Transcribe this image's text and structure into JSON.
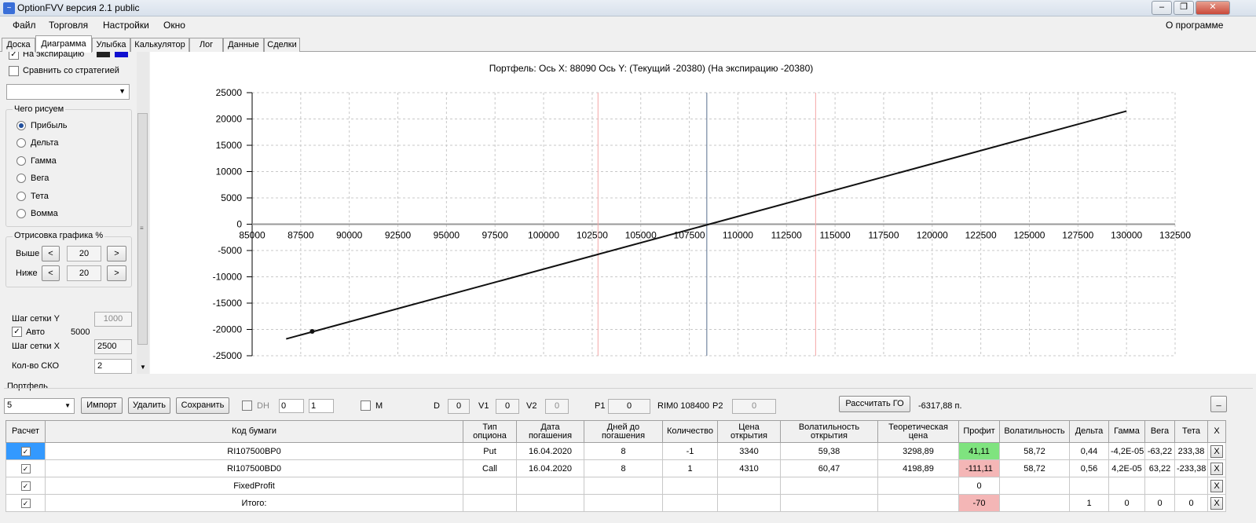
{
  "window": {
    "title": "OptionFVV версия 2.1 public"
  },
  "menu": {
    "items": [
      "Файл",
      "Торговля",
      "Настройки",
      "Окно"
    ],
    "about": "О программе"
  },
  "tabs": [
    "Доска",
    "Диаграмма",
    "Улыбка",
    "Калькулятор",
    "Лог",
    "Данные",
    "Сделки"
  ],
  "left": {
    "expiry_label": "На экспирацию",
    "compare_label": "Сравнить со стратегией",
    "strategy_value": "",
    "draw_group": "Чего рисуем",
    "options": [
      "Прибыль",
      "Дельта",
      "Гамма",
      "Вега",
      "Тета",
      "Вомма"
    ],
    "render_group": "Отрисовка графика %",
    "above_label": "Выше",
    "above_value": "20",
    "below_label": "Ниже",
    "below_value": "20",
    "prev": "<",
    "next": ">",
    "grid_y_label": "Шаг сетки Y",
    "grid_y_value": "1000",
    "auto_label": "Авто",
    "auto_value": "5000",
    "grid_x_label": "Шаг сетки X",
    "grid_x_value": "2500",
    "sko_label": "Кол-во СКО",
    "sko_value": "2"
  },
  "chart_header": "Портфель: Ось X: 88090 Ось Y:  (Текущий -20380)  (На экспирацию -20380)",
  "chart_data": {
    "type": "line",
    "title": "Портфель: Ось X: 88090 Ось Y:  (Текущий -20380)  (На экспирацию -20380)",
    "xlim": [
      85000,
      132500
    ],
    "ylim": [
      -25000,
      25000
    ],
    "x_ticks": [
      "85000",
      "87500",
      "90000",
      "92500",
      "95000",
      "97500",
      "100000",
      "102500",
      "105000",
      "107500",
      "110000",
      "112500",
      "115000",
      "117500",
      "120000",
      "122500",
      "125000",
      "127500",
      "130000",
      "132500"
    ],
    "y_ticks": [
      "25000",
      "20000",
      "15000",
      "10000",
      "5000",
      "0",
      "-5000",
      "-10000",
      "-15000",
      "-20000",
      "-25000"
    ],
    "grid": true,
    "series": [
      {
        "x": [
          86750,
          130000
        ],
        "y": [
          -21800,
          21500
        ]
      }
    ],
    "marker": {
      "x": 88090,
      "y": -20380
    },
    "vlines": [
      {
        "x": 102800,
        "color": "#f4a6a6"
      },
      {
        "x": 108400,
        "color": "#5a6f8f"
      },
      {
        "x": 114000,
        "color": "#f4a6a6"
      }
    ]
  },
  "portfolio": {
    "group_label": "Портфель",
    "selected": "5",
    "import": "Импорт",
    "delete": "Удалить",
    "save": "Сохранить",
    "dh_label": "DH",
    "dh_v1": "0",
    "dh_v2": "1",
    "m_label": "M",
    "d_label": "D",
    "d_value": "0",
    "v1_label": "V1",
    "v1_value": "0",
    "v2_label": "V2",
    "v2_value": "0",
    "p1_label": "P1",
    "p1_value": "0",
    "rim_label": "RIM0 108400",
    "p2_label": "P2",
    "p2_value": "0",
    "calc_go": "Рассчитать ГО",
    "go_value": "-6317,88 п.",
    "minimize": "_"
  },
  "table": {
    "headers": [
      "Расчет",
      "Код бумаги",
      "Тип опциона",
      "Дата погашения",
      "Дней до погашения",
      "Количество",
      "Цена открытия",
      "Волатильность открытия",
      "Теоретическая цена",
      "Профит",
      "Волатильность",
      "Дельта",
      "Гамма",
      "Вега",
      "Тета",
      "X"
    ],
    "rows": [
      {
        "code": "RI107500BP0",
        "type": "Put",
        "date": "16.04.2020",
        "days": "8",
        "qty": "-1",
        "price": "3340",
        "vol_open": "59,38",
        "theo": "3298,89",
        "profit": "41,11",
        "profit_color": "#7fe37f",
        "vol": "58,72",
        "delta": "0,44",
        "gamma": "-4,2E-05",
        "vega": "-63,22",
        "theta": "233,38",
        "x": "X",
        "selected": true
      },
      {
        "code": "RI107500BD0",
        "type": "Call",
        "date": "16.04.2020",
        "days": "8",
        "qty": "1",
        "price": "4310",
        "vol_open": "60,47",
        "theo": "4198,89",
        "profit": "-111,11",
        "profit_color": "#f4b6b6",
        "vol": "58,72",
        "delta": "0,56",
        "gamma": "4,2E-05",
        "vega": "63,22",
        "theta": "-233,38",
        "x": "X",
        "selected": false
      },
      {
        "code": "FixedProfit",
        "type": "",
        "date": "",
        "days": "",
        "qty": "",
        "price": "",
        "vol_open": "",
        "theo": "",
        "profit": "0",
        "profit_color": "#ffffff",
        "vol": "",
        "delta": "",
        "gamma": "",
        "vega": "",
        "theta": "",
        "x": "X",
        "selected": false
      },
      {
        "code": "Итого:",
        "type": "",
        "date": "",
        "days": "",
        "qty": "",
        "price": "",
        "vol_open": "",
        "theo": "",
        "profit": "-70",
        "profit_color": "#f4b6b6",
        "vol": "",
        "delta": "1",
        "gamma": "0",
        "vega": "0",
        "theta": "0",
        "x": "X",
        "selected": false
      }
    ]
  }
}
